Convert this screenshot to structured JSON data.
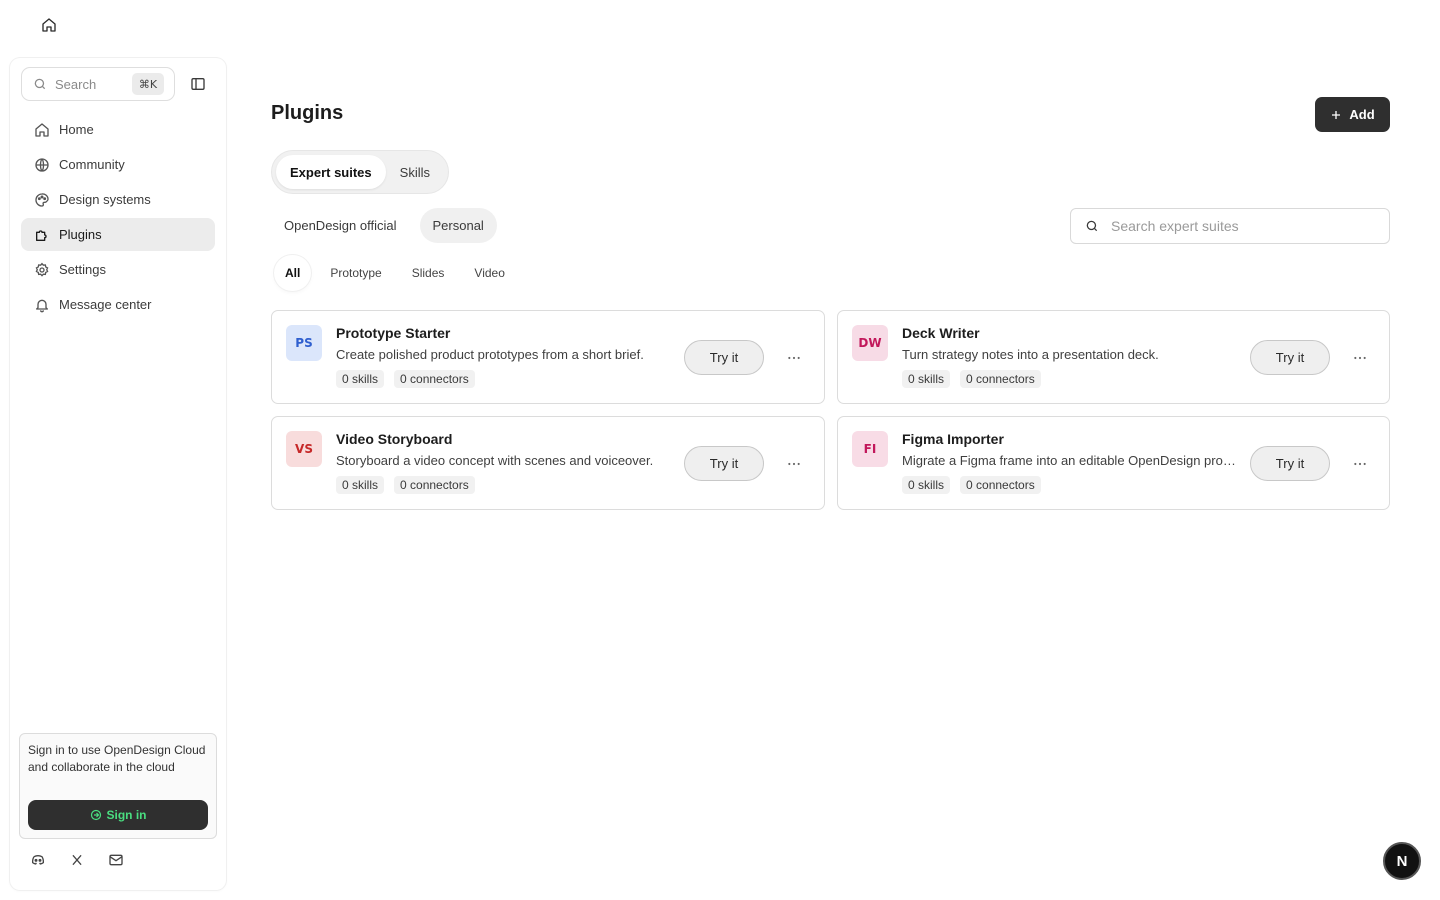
{
  "top": {
    "home_icon": "home-icon"
  },
  "sidebar": {
    "search": {
      "label": "Search",
      "shortcut": "⌘K"
    },
    "items": [
      {
        "label": "Home",
        "icon": "home-icon"
      },
      {
        "label": "Community",
        "icon": "globe-icon"
      },
      {
        "label": "Design systems",
        "icon": "palette-icon"
      },
      {
        "label": "Plugins",
        "icon": "plugin-icon",
        "active": true
      },
      {
        "label": "Settings",
        "icon": "gear-icon"
      },
      {
        "label": "Message center",
        "icon": "bell-icon"
      }
    ],
    "signin": {
      "text": "Sign in to use OpenDesign Cloud and collaborate in the cloud",
      "button": "Sign in"
    },
    "social": [
      "discord-icon",
      "x-icon",
      "mail-icon"
    ]
  },
  "main": {
    "title": "Plugins",
    "add_label": "Add",
    "segments": [
      {
        "label": "Expert suites",
        "active": true
      },
      {
        "label": "Skills"
      }
    ],
    "source_tabs": [
      {
        "label": "OpenDesign official"
      },
      {
        "label": "Personal",
        "active": true
      }
    ],
    "search_placeholder": "Search expert suites",
    "filters": [
      {
        "label": "All",
        "active": true
      },
      {
        "label": "Prototype"
      },
      {
        "label": "Slides"
      },
      {
        "label": "Video"
      }
    ],
    "cards": [
      {
        "badge": "PS",
        "badge_bg": "#dbe6fb",
        "badge_fg": "#2f5fcf",
        "title": "Prototype Starter",
        "desc": "Create polished product prototypes from a short brief.",
        "skills": "0 skills",
        "connectors": "0 connectors",
        "try": "Try it"
      },
      {
        "badge": "DW",
        "badge_bg": "#f7dbe6",
        "badge_fg": "#c2185b",
        "title": "Deck Writer",
        "desc": "Turn strategy notes into a presentation deck.",
        "skills": "0 skills",
        "connectors": "0 connectors",
        "try": "Try it"
      },
      {
        "badge": "VS",
        "badge_bg": "#f8dcdc",
        "badge_fg": "#c62828",
        "title": "Video Storyboard",
        "desc": "Storyboard a video concept with scenes and voiceover.",
        "skills": "0 skills",
        "connectors": "0 connectors",
        "try": "Try it"
      },
      {
        "badge": "FI",
        "badge_bg": "#f8dce6",
        "badge_fg": "#c2185b",
        "title": "Figma Importer",
        "desc": "Migrate a Figma frame into an editable OpenDesign project.",
        "skills": "0 skills",
        "connectors": "0 connectors",
        "try": "Try it"
      }
    ]
  },
  "corner_badge": "N"
}
